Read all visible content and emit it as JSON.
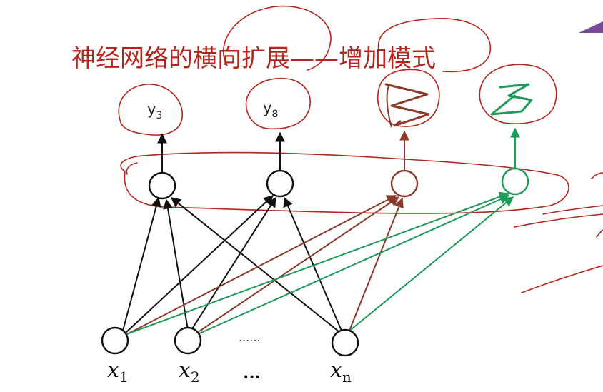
{
  "title": "神经网络的横向扩展——增加模式",
  "outputs": [
    {
      "label": "y",
      "sub": "3"
    },
    {
      "label": "y",
      "sub": "8"
    }
  ],
  "inputs": [
    {
      "label": "x",
      "sub": "1"
    },
    {
      "label": "x",
      "sub": "2"
    },
    {
      "label": "x",
      "sub": "n"
    }
  ],
  "ellipsis_middle": "......",
  "ellipsis_bottom": "...",
  "colors": {
    "black": "#111111",
    "brown": "#8b3a2a",
    "green": "#1e9a5a",
    "annotation_red": "#b5251c",
    "corner_purple": "#7a4a9a"
  }
}
